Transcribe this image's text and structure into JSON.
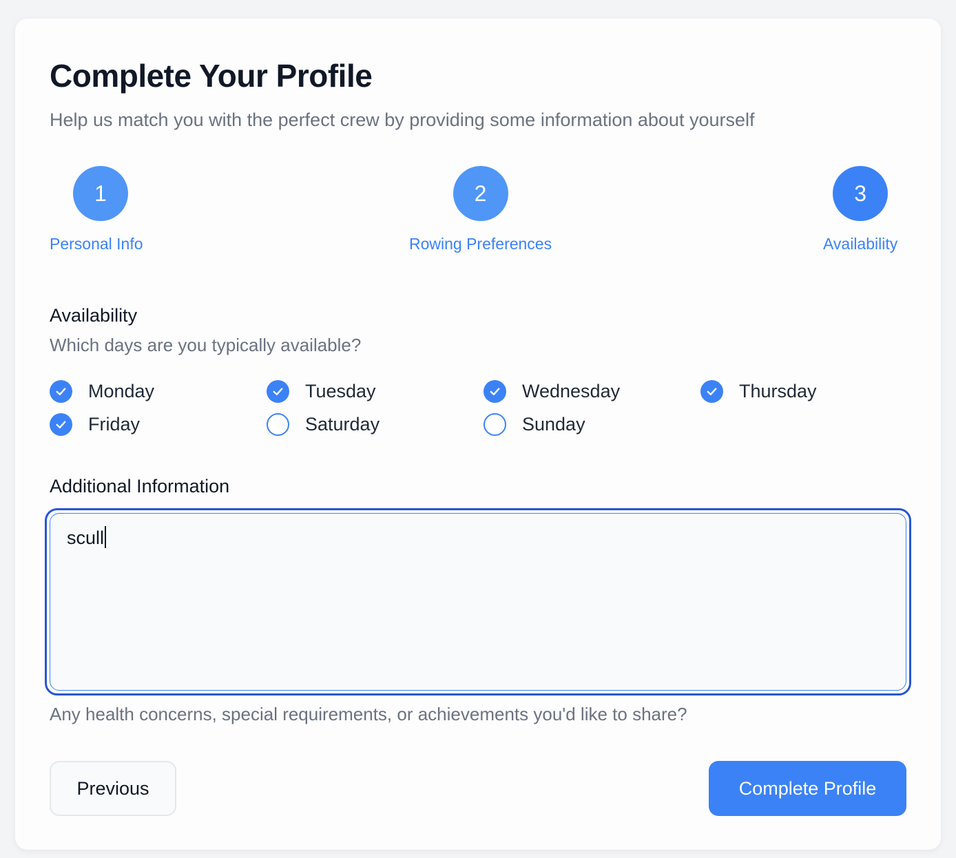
{
  "header": {
    "title": "Complete Your Profile",
    "subtitle": "Help us match you with the perfect crew by providing some information about yourself"
  },
  "steps": [
    {
      "number": "1",
      "label": "Personal Info",
      "color": "#4f96f7"
    },
    {
      "number": "2",
      "label": "Rowing Preferences",
      "color": "#4f96f7"
    },
    {
      "number": "3",
      "label": "Availability",
      "color": "#3b82f6"
    }
  ],
  "availability": {
    "label": "Availability",
    "help": "Which days are you typically available?",
    "days": [
      {
        "label": "Monday",
        "checked": true
      },
      {
        "label": "Tuesday",
        "checked": true
      },
      {
        "label": "Wednesday",
        "checked": true
      },
      {
        "label": "Thursday",
        "checked": true
      },
      {
        "label": "Friday",
        "checked": true
      },
      {
        "label": "Saturday",
        "checked": false
      },
      {
        "label": "Sunday",
        "checked": false
      }
    ]
  },
  "additional": {
    "label": "Additional Information",
    "value": "scull",
    "help": "Any health concerns, special requirements, or achievements you'd like to share?"
  },
  "buttons": {
    "previous": "Previous",
    "complete": "Complete Profile"
  },
  "colors": {
    "accent": "#3b82f6",
    "focus_ring": "#2456d3"
  }
}
